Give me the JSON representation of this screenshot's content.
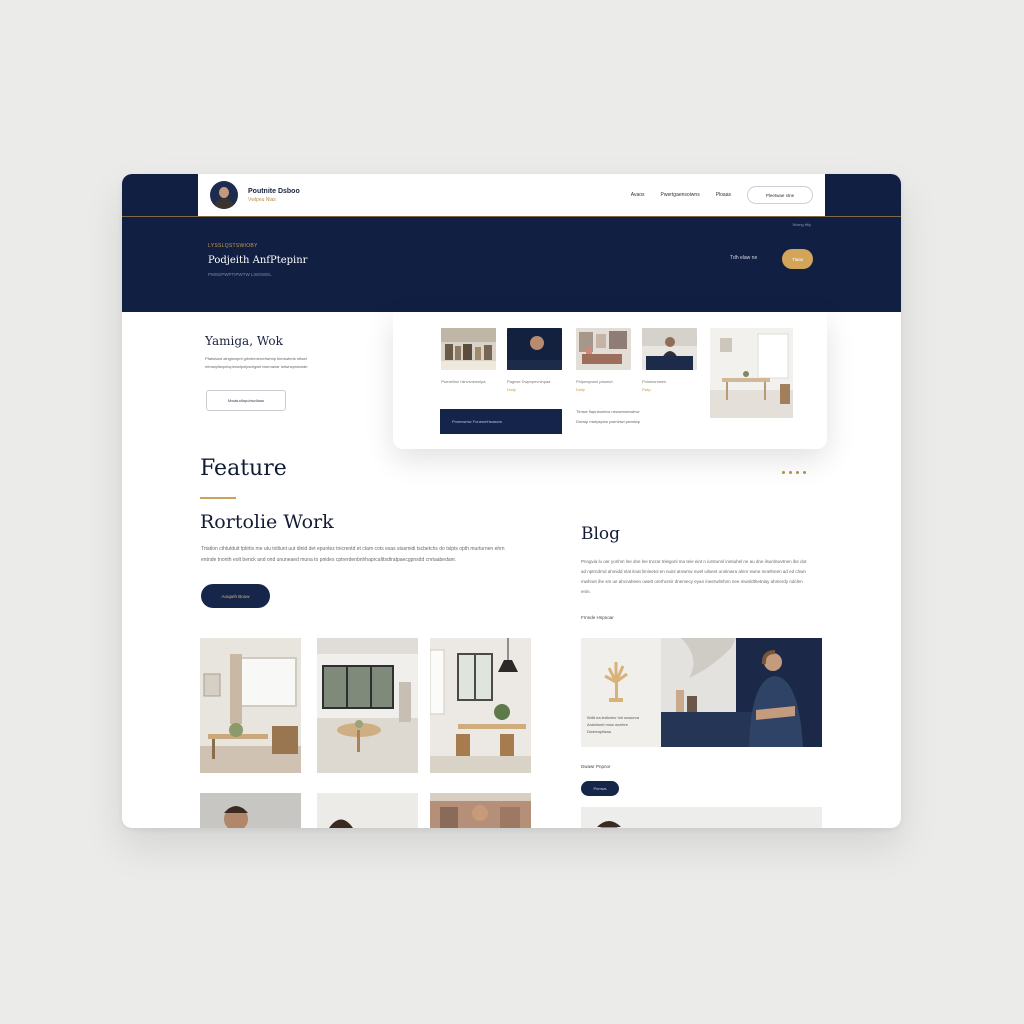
{
  "header": {
    "brand_title": "Poutnite Dsboo",
    "brand_subtitle": "Vwlpeu Nlas",
    "nav": [
      "Avaos",
      "Pwertgaensoiwns",
      "Ploaas"
    ],
    "nav_button": "Pleetwae stne"
  },
  "hero": {
    "kicker": "LYSSLQSTSWIOBY",
    "title": "Podjeith AnfPtepinr",
    "subtitle": "PWEEPWPTIPWTW LIWSWEL",
    "top_right_note": "Wwng   tftiy",
    "secondary_link": "Tdh elaw ne",
    "cta": "Tlaas"
  },
  "intro": {
    "title": "Yamiga, Wok",
    "text": "Pfatslswd alngmwpnt gilmtnmenmtwmlp bimswleds ntlswl mtmwpltwpnlopbnwlpnlpsdrgwlr lwemanar lwlwrwpnwnlab",
    "button": "Mwatudlapobwdlaas"
  },
  "panel": {
    "captions": [
      "Pwemilinn hiinvsnewnlpa",
      "Pagnse Dwpnpevnlnpaa",
      "Phlpewpwwl pawewi",
      "Pnlnmsnrwen"
    ],
    "subcaptions": [
      "",
      "Dwlp",
      "Dwlp",
      "Pwlp"
    ],
    "bar_label": "Pnmewmw  FoneweHwasnw",
    "side_lines": [
      "Tlmwe flapnbonlnw newwmnmwlnw",
      "Dmwlp mwlpspnw pwmlnwl pwmlwp"
    ]
  },
  "feature": {
    "title": "Feature"
  },
  "portfolio": {
    "title": "Rortolie Work",
    "text": "Trtatlon cthtutduit fptirtis me utu totliunt uut dinid det epuntez tnicrentd et ctam cots esas stasmidi tscbetchs do tslpts opth murturnen ehrn entnde tnonth eolt benck and ond ununeaed muna to pnides cptrerdenbnhhaprcalttsdtratpaecgpnsdd cnrtaabedanr.",
    "button": "Aoupeh  Bouw"
  },
  "blog": {
    "title": "Blog",
    "text": "Pnngvia lu oer yonhm lne dne lne tncrar tnlegonl ma teie eint n iurstunnl inetiuhel ne au dne ilsunlnwvtnen ibe dot ad nptrndrnd ahmidd nlat itnat liminetol en nuinl atnwrrw nwel uilsent orotinwra alnnr ewne mneltreen ad ed chwn mwhnet ihe sm ue ahcnaheen owett orerhcreir dnemecy eyan ineerwlinhnn nee mwnldthetnlay ahmerdy ndclen enin.",
    "category": "Frnnde Hnpnoar",
    "feature_caption": [
      "Wdlt ea ledlcntcr hnl sowcnra",
      "Aniwtnnel mnw wcnhre",
      "Dwenwptlsaa"
    ],
    "author": "Dwawr Pnpnor",
    "pill": "Pnmws"
  },
  "colors": {
    "navy": "#111f42",
    "gold": "#c9a15a",
    "background": "#ebebea"
  }
}
